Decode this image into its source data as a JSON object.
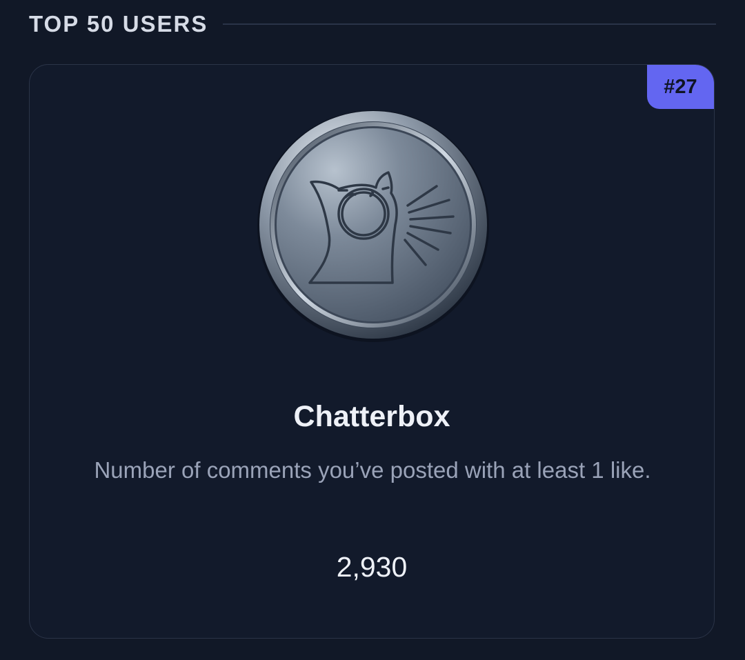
{
  "section": {
    "title": "TOP 50 USERS"
  },
  "achievement": {
    "rank": "#27",
    "name": "Chatterbox",
    "description": "Number of comments you’ve posted with at least 1 like.",
    "count": "2,930",
    "icon": "chatterbox-cat-medal-icon"
  },
  "colors": {
    "background": "#111827",
    "card_border": "#2b3448",
    "badge_accent": "#6366f1",
    "title_text": "#eef1f7",
    "muted_text": "#9aa3b8"
  }
}
